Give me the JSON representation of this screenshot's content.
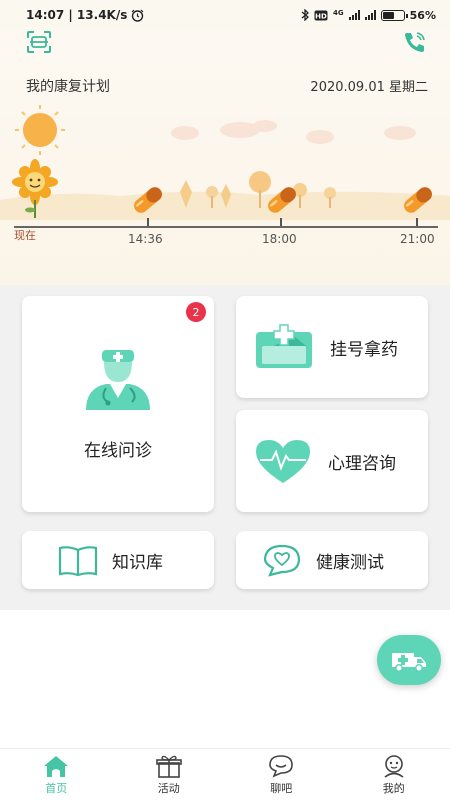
{
  "status_bar": {
    "time": "14:07 | 13.4K/s",
    "network": "4G",
    "battery": "56",
    "battery_pct": 56
  },
  "plan": {
    "title": "我的康复计划",
    "date": "2020.09.01 星期二",
    "now_label": "现在",
    "times": [
      "14:36",
      "18:00",
      "21:00"
    ]
  },
  "cards": {
    "online_consult": {
      "label": "在线问诊",
      "badge": "2"
    },
    "register": {
      "label": "挂号拿药"
    },
    "psych": {
      "label": "心理咨询"
    },
    "knowledge": {
      "label": "知识库"
    },
    "health_test": {
      "label": "健康测试"
    }
  },
  "nav": {
    "items": [
      {
        "label": "首页",
        "icon": "home-icon",
        "active": true
      },
      {
        "label": "活动",
        "icon": "gift-icon",
        "active": false
      },
      {
        "label": "聊吧",
        "icon": "chat-icon",
        "active": false
      },
      {
        "label": "我的",
        "icon": "profile-icon",
        "active": false
      }
    ]
  },
  "colors": {
    "accent": "#46c5a6",
    "badge": "#e8334a"
  }
}
